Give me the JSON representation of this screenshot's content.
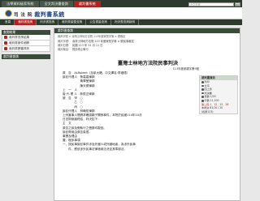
{
  "top_tabs": [
    "法學資料檢索系統",
    "全文判決書查詢",
    "裁判書系統"
  ],
  "search": {
    "placeholder": "全文檢索"
  },
  "go_label": "GO",
  "header": {
    "org": "司 法 院",
    "title": "裁判書系統"
  },
  "nav": [
    "首頁",
    "裁判書查詢",
    "判決書查詢",
    "裁判書彙整查詢",
    "公告書量查詢",
    "判決書查詢說明"
  ],
  "sidebar": {
    "title": "查詢結果",
    "items": [
      "裁判書查詢結果",
      "裁判書案件細節",
      "裁判書歷審資訊"
    ],
    "section2": "裁判書查詢"
  },
  "main": {
    "header": "裁判書查詢",
    "breadcrumb": "裁判字號 > 臺灣士林地方法院 113年度家聲字第 × 號裁定",
    "meta": [
      {
        "k": "裁判字號:",
        "v": "臺灣士林地方法院 113 年度家聲字第 × 號民事裁定"
      },
      {
        "k": "裁判日期:",
        "v": "民國 113 年 11 月 11 日"
      },
      {
        "k": "裁判案由:",
        "v": "聲請停止執行"
      }
    ],
    "title": "臺灣士林地方法院民事判決",
    "case_no": "113年度家親字第9號",
    "lines": [
      "原　告　ALRobert（加拿大籍，中文譯名:李禮德）",
      "訴訟代理人　蔡嘉嘉律師",
      "　　　　　　黃翠瑩律師",
      "　　　　　　陳天德律師",
      "上　一　人",
      "複 代 理 人　林辰正律師",
      "被　告　甲　○",
      "　　　　乙　○",
      "　　　　丙　○",
      "訴訟代理人　林翰佑律師",
      "上列當事人間請求確認親子關係事件，本院於民國114年10月",
      "日言詞辯論終結，判決如下：",
      "主　文",
      "原告之訴及假執行之聲請均駁回。",
      "訴訟費用由原告負擔。",
      "事實及理由",
      "壹、程序事項",
      "一、按民事訴訟事件涉及外國人或外國地者，為涉外民事",
      "　　件，應依涉外民事法律適用法決定其準據法。"
    ]
  },
  "infobox": {
    "title": "裁判書資訊",
    "rows": [
      "列印",
      "分享",
      "回上頁",
      "判決書",
      "頁數 1/20",
      "字數 11,100"
    ],
    "highlight": "第二頁 1．12．15．28",
    "extra": [
      "本判決 81/10 / 20",
      "(檢索123)"
    ]
  }
}
